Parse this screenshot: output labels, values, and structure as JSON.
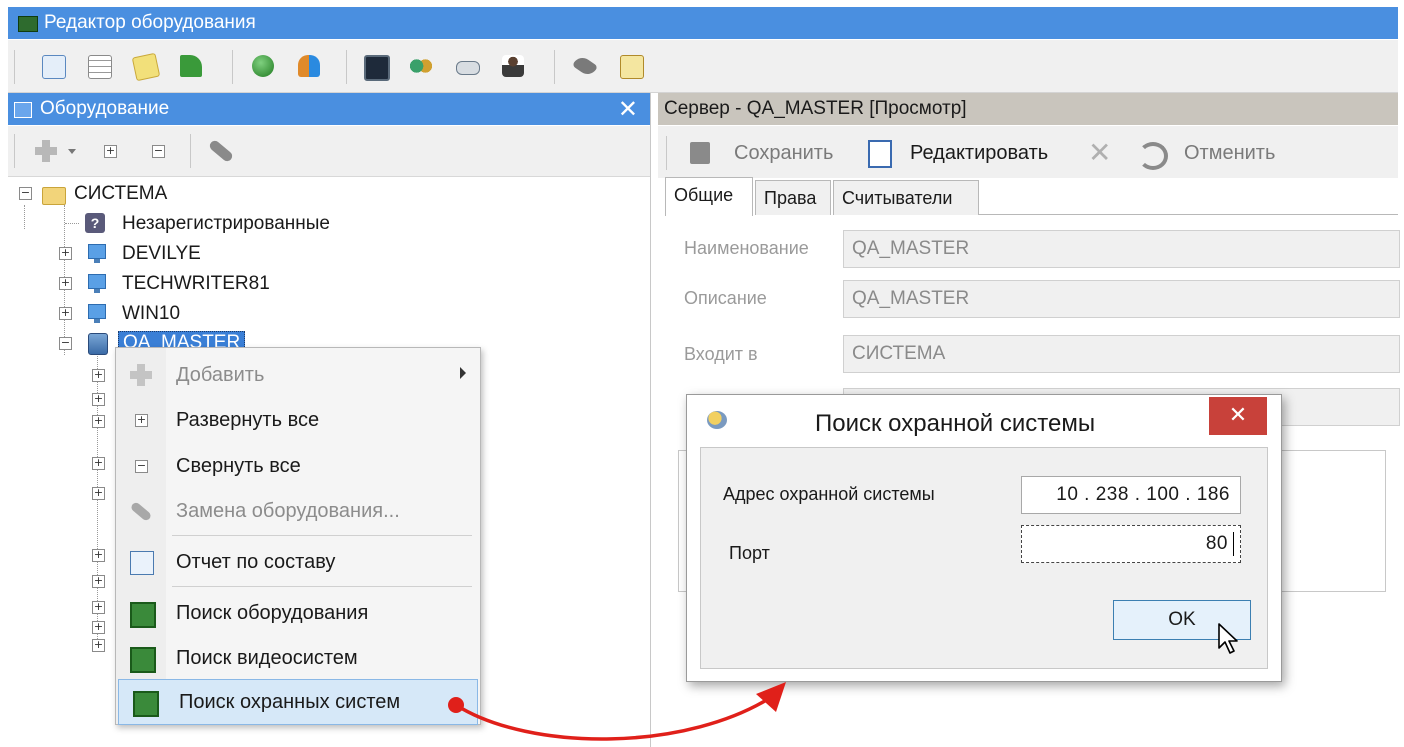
{
  "window": {
    "title": "Редактор оборудования"
  },
  "left_panel": {
    "title": "Оборудование",
    "close_glyph": "✕",
    "tree": {
      "root": "СИСТЕМА",
      "items": [
        "Незарегистрированные",
        "DEVILYE",
        "TECHWRITER81",
        "WIN10",
        "QA_MASTER"
      ],
      "selected": "QA_MASTER"
    }
  },
  "context_menu": {
    "items": [
      {
        "label": "Добавить",
        "disabled": true,
        "submenu": true
      },
      {
        "label": "Развернуть все"
      },
      {
        "label": "Свернуть все"
      },
      {
        "label": "Замена оборудования...",
        "disabled": true
      },
      {
        "label": "Отчет по составу"
      },
      {
        "label": "Поиск оборудования"
      },
      {
        "label": "Поиск видеосистем"
      },
      {
        "label": "Поиск охранных систем",
        "highlighted": true
      }
    ]
  },
  "right_panel": {
    "title": "Сервер - QA_MASTER [Просмотр]",
    "toolbar": {
      "save": "Сохранить",
      "edit": "Редактировать",
      "cancel": "Отменить"
    },
    "tabs": [
      "Общие",
      "Права",
      "Считыватели"
    ],
    "active_tab": "Общие",
    "fields": {
      "name_label": "Наименование",
      "name_value": "QA_MASTER",
      "desc_label": "Описание",
      "desc_value": "QA_MASTER",
      "parent_label": "Входит в",
      "parent_value": "СИСТЕМА"
    }
  },
  "dialog": {
    "title": "Поиск охранной системы",
    "close_glyph": "✕",
    "address_label": "Адрес охранной системы",
    "address_value": "10  . 238 . 100 . 186",
    "port_label": "Порт",
    "port_value": "80",
    "ok_label": "OK"
  },
  "colors": {
    "titlebar": "#4a8fe0",
    "highlight": "#d6e8f8",
    "close_red": "#c8413a",
    "arrow_red": "#e0201a"
  }
}
